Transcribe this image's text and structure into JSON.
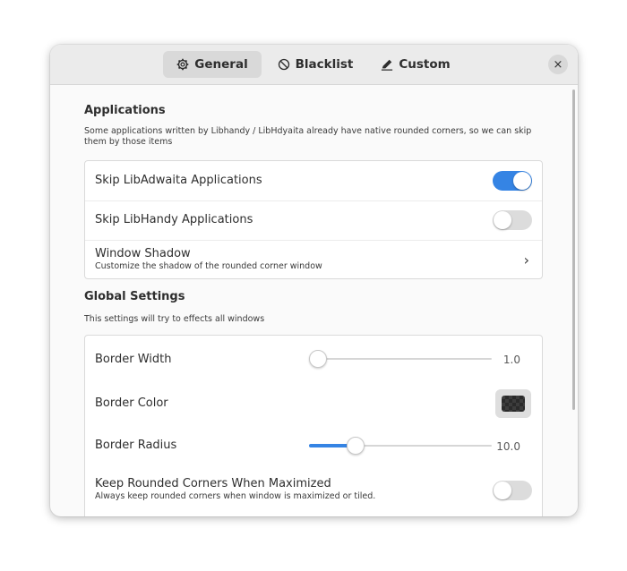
{
  "tabs": [
    {
      "label": "General",
      "icon": "gear-icon",
      "active": true
    },
    {
      "label": "Blacklist",
      "icon": "prohibit-icon",
      "active": false
    },
    {
      "label": "Custom",
      "icon": "pen-icon",
      "active": false
    }
  ],
  "window": {
    "close_glyph": "×"
  },
  "applications": {
    "title": "Applications",
    "description": "Some applications written by Libhandy / LibHdyaita already have native rounded corners, so we can skip them by those items",
    "rows": [
      {
        "label": "Skip LibAdwaita Applications",
        "toggle": true
      },
      {
        "label": "Skip LibHandy Applications",
        "toggle": false
      },
      {
        "label": "Window Shadow",
        "subtitle": "Customize the shadow of the rounded corner window",
        "chevron": "›"
      }
    ]
  },
  "global_settings": {
    "title": "Global Settings",
    "description": "This settings will try to effects all windows",
    "border_width": {
      "label": "Border Width",
      "value": "1.0",
      "fraction": 0.0
    },
    "border_color": {
      "label": "Border Color",
      "color": "#2a2a2a"
    },
    "border_radius": {
      "label": "Border Radius",
      "value": "10.0",
      "fraction": 0.25
    },
    "keep_rounded": {
      "label": "Keep Rounded Corners When Maximized",
      "subtitle": "Always keep rounded corners when window is maximized or tiled.",
      "toggle": false
    }
  },
  "colors": {
    "accent": "#3584e4",
    "switch_off": "#dcdcdc"
  }
}
